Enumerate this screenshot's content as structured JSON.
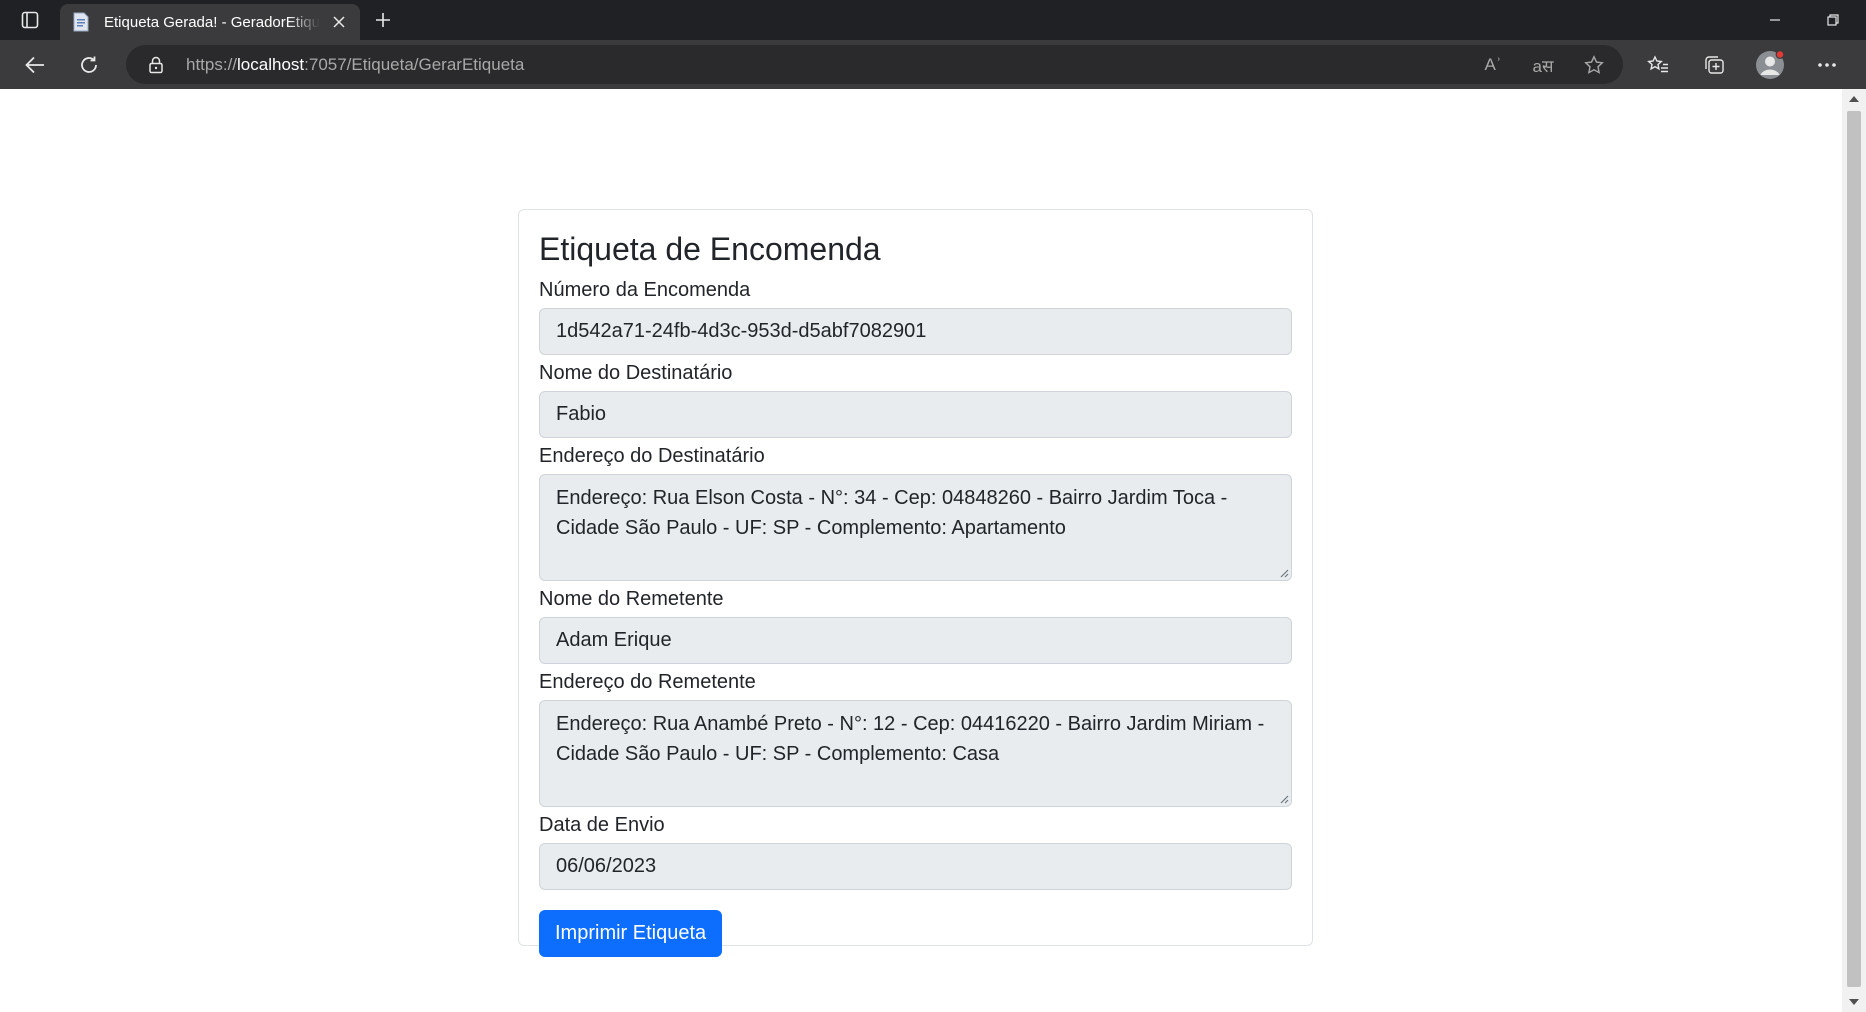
{
  "browser": {
    "tab_title": "Etiqueta Gerada! - GeradorEtiqueta",
    "url_scheme": "https://",
    "url_host": "localhost",
    "url_path": ":7057/Etiqueta/GerarEtiqueta",
    "read_aloud_label": "Aʾ",
    "translate_label": "aस"
  },
  "page": {
    "card_title": "Etiqueta de Encomenda",
    "fields": {
      "numero_label": "Número da Encomenda",
      "numero_value": "1d542a71-24fb-4d3c-953d-d5abf7082901",
      "destinatario_label": "Nome do Destinatário",
      "destinatario_value": "Fabio",
      "endereco_destinatario_label": "Endereço do Destinatário",
      "endereco_destinatario_value": "Endereço: Rua Elson Costa - N°: 34 - Cep: 04848260 - Bairro Jardim Toca - Cidade São Paulo - UF: SP - Complemento: Apartamento",
      "remetente_label": "Nome do Remetente",
      "remetente_value": "Adam Erique",
      "endereco_remetente_label": "Endereço do Remetente",
      "endereco_remetente_value": "Endereço: Rua Anambé Preto - N°: 12 - Cep: 04416220 - Bairro Jardim Miriam - Cidade São Paulo - UF: SP - Complemento: Casa",
      "data_envio_label": "Data de Envio",
      "data_envio_value": "06/06/2023"
    },
    "print_button_label": "Imprimir Etiqueta"
  },
  "colors": {
    "primary_button": "#0d6efd",
    "readonly_field": "#e9ecef",
    "browser_frame": "#202124"
  }
}
